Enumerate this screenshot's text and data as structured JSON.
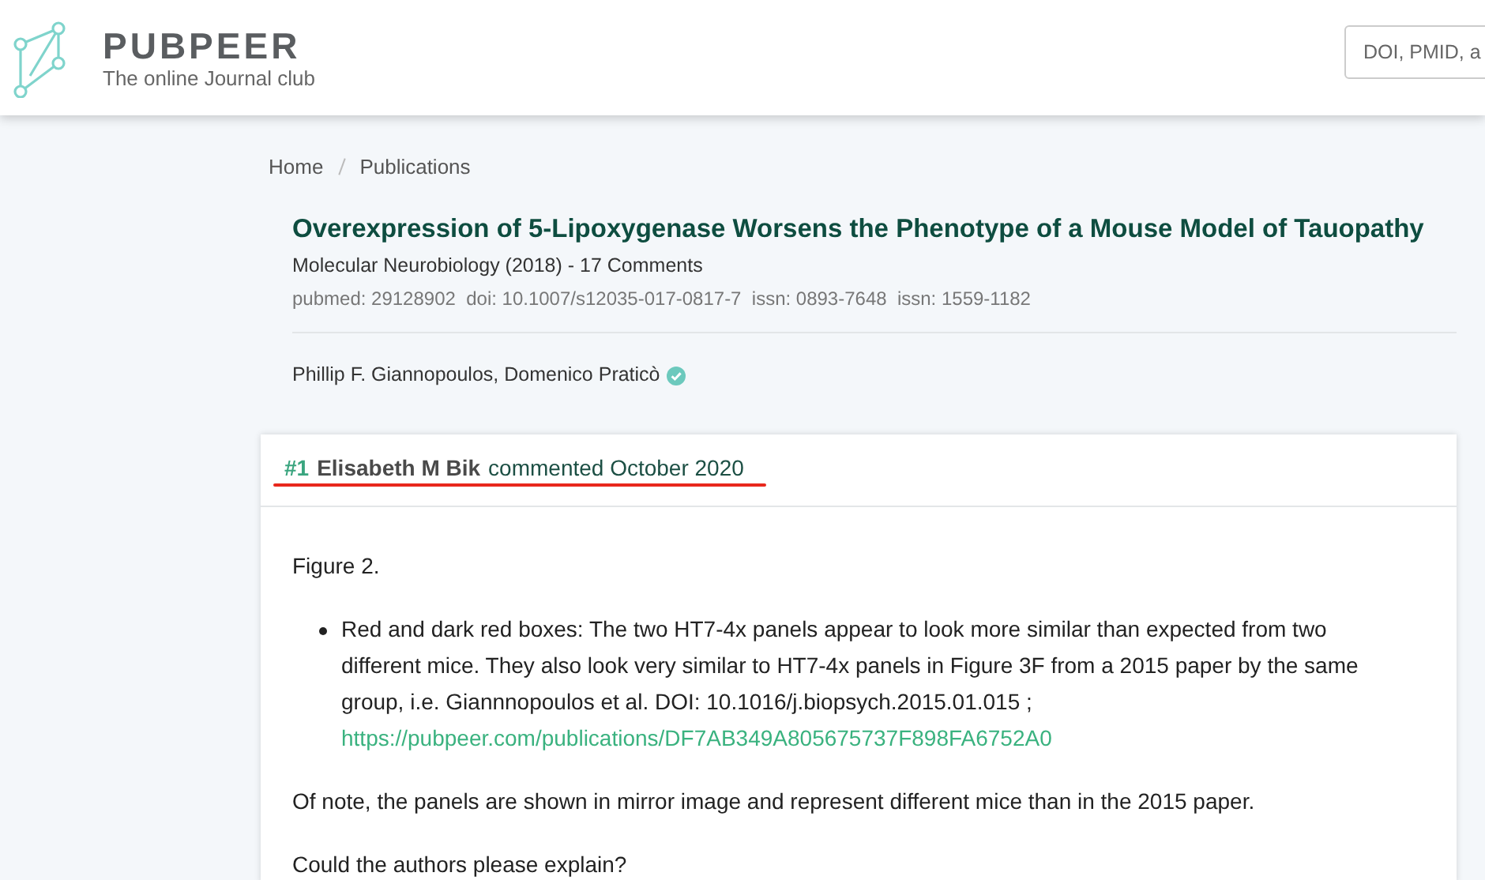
{
  "header": {
    "brand": "PUBPEER",
    "tagline": "The online Journal club",
    "search": {
      "placeholder": "DOI, PMID, a"
    }
  },
  "breadcrumb": [
    "Home",
    "Publications"
  ],
  "publication": {
    "title": "Overexpression of 5-Lipoxygenase Worsens the Phenotype of a Mouse Model of Tauopathy",
    "journal": "Molecular Neurobiology (2018) - 17 Comments",
    "identifiers": "pubmed: 29128902  doi: 10.1007/s12035-017-0817-7  issn: 0893-7648  issn: 1559-1182",
    "authors": "Phillip F. Giannopoulos, Domenico Praticò",
    "verified": true
  },
  "comment": {
    "number": "#1",
    "author": "Elisabeth M Bik",
    "date": "commented October 2020",
    "underlined": true,
    "body": [
      {
        "kind": "paragraph",
        "text": "Figure 2."
      },
      {
        "kind": "bullet",
        "text": "Red and dark red boxes: The two HT7-4x panels appear to look more similar than expected from two different mice. They also look very similar to HT7-4x panels in Figure 3F from a 2015 paper by the same group, i.e. Giannnopoulos et al. DOI: 10.1016/j.biopsych.2015.01.015 ;",
        "link": "https://pubpeer.com/publications/DF7AB349A805675737F898FA6752A0"
      },
      {
        "kind": "paragraph",
        "text": "Of note, the panels are shown in mirror image and represent different mice than in the 2015 paper."
      },
      {
        "kind": "paragraph",
        "text": "Could the authors please explain?"
      }
    ]
  }
}
